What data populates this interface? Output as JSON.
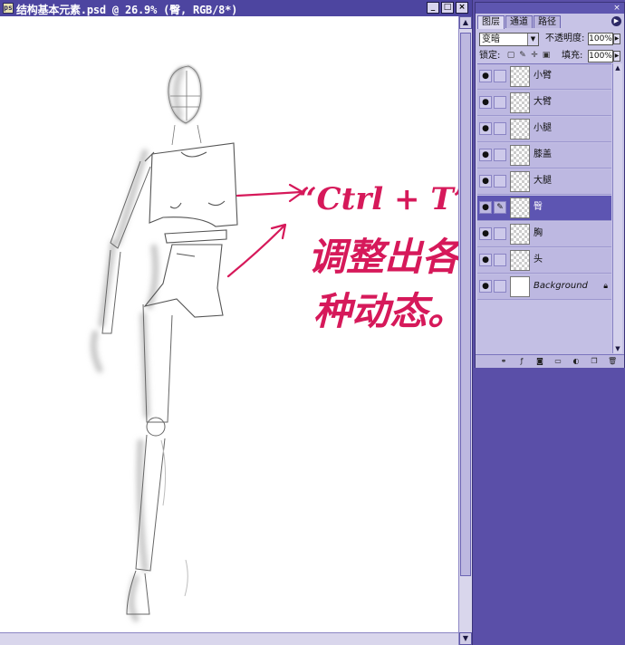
{
  "document": {
    "title": "结构基本元素.psd @ 26.9% (臀, RGB/8*)",
    "icon": "document-icon",
    "window_buttons": [
      "minimize-button",
      "restore-button",
      "close-button"
    ]
  },
  "annotation": {
    "line1": "“Ctrl + T”",
    "line2": "调整出各",
    "line3": "种动态。",
    "color": "#d6195a"
  },
  "layers_panel": {
    "tabs": [
      "图层",
      "通道",
      "路径"
    ],
    "active_tab": 0,
    "blend_mode": "变暗",
    "opacity_label": "不透明度:",
    "opacity_value": "100%",
    "lock_label": "锁定:",
    "fill_label": "填充:",
    "fill_value": "100%",
    "layers": [
      {
        "name": "小臂",
        "visible": true,
        "active": false,
        "thumb": "transparent"
      },
      {
        "name": "大臂",
        "visible": true,
        "active": false,
        "thumb": "transparent"
      },
      {
        "name": "小腿",
        "visible": true,
        "active": false,
        "thumb": "transparent"
      },
      {
        "name": "膝盖",
        "visible": true,
        "active": false,
        "thumb": "transparent"
      },
      {
        "name": "大腿",
        "visible": true,
        "active": false,
        "thumb": "transparent"
      },
      {
        "name": "臀",
        "visible": true,
        "active": true,
        "thumb": "transparent"
      },
      {
        "name": "胸",
        "visible": true,
        "active": false,
        "thumb": "transparent"
      },
      {
        "name": "头",
        "visible": true,
        "active": false,
        "thumb": "transparent"
      },
      {
        "name": "Background",
        "visible": true,
        "active": false,
        "thumb": "white",
        "locked": true
      }
    ]
  },
  "colors": {
    "workspace": "#5a4fa8",
    "titlebar": "#4d45a0",
    "active_layer": "#5d55b2"
  }
}
